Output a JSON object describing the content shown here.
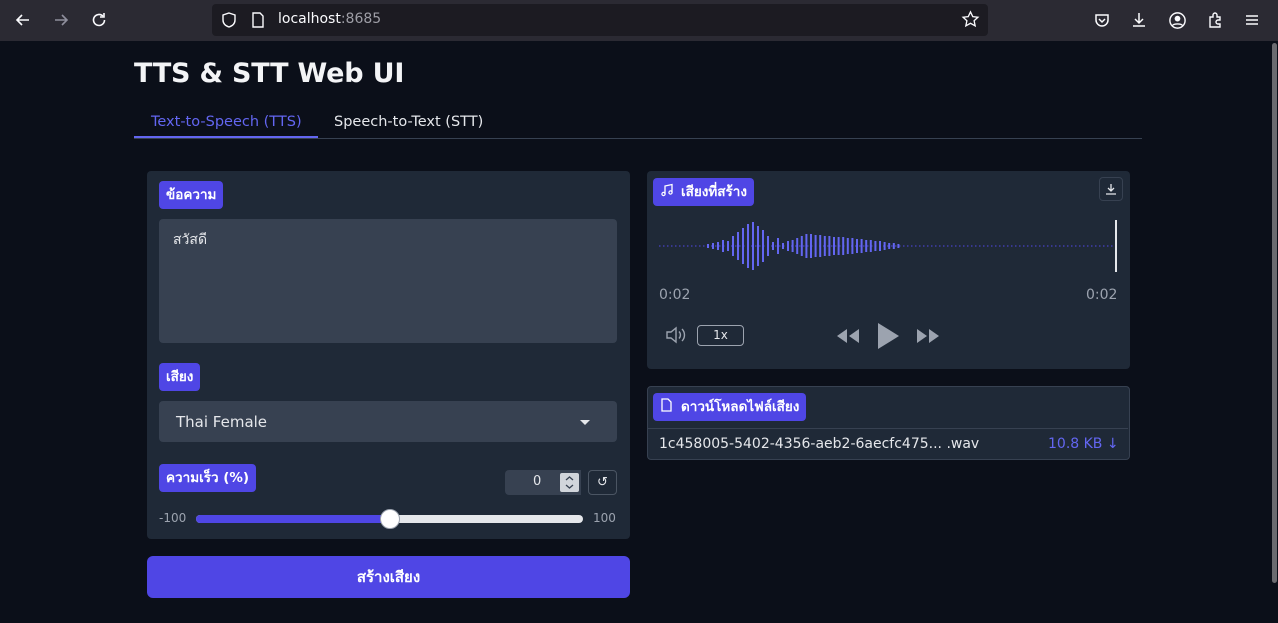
{
  "browser": {
    "url_host": "localhost",
    "url_port": ":8685"
  },
  "app": {
    "title": "TTS & STT Web UI"
  },
  "tabs": [
    {
      "label": "Text-to-Speech (TTS)",
      "active": true
    },
    {
      "label": "Speech-to-Text (STT)",
      "active": false
    }
  ],
  "tts": {
    "text_label": "ข้อความ",
    "text_value": "สวัสดี",
    "voice_label": "เสียง",
    "voice_value": "Thai Female",
    "speed_label": "ความเร็ว (%)",
    "speed_value": "0",
    "reset_glyph": "↺",
    "slider_min": "-100",
    "slider_max": "100",
    "slider_level": 0.5,
    "generate_button": "สร้างเสียง"
  },
  "audio": {
    "label": "เสียงที่สร้าง",
    "time_current": "0:02",
    "time_total": "0:02",
    "playback_rate": "1x"
  },
  "download": {
    "label": "ดาวน์โหลดไฟล์เสียง",
    "file_name": "1c458005-5402-4356-aeb2-6aecfc475... .wav",
    "file_size": "10.8 KB ↓"
  },
  "colors": {
    "accent": "#4f46e5",
    "accent_text": "#6366f1",
    "panel": "#1f2937",
    "page_bg": "#0b0f19"
  },
  "icons": [
    "back-icon",
    "forward-icon",
    "reload-icon",
    "shield-icon",
    "page-icon",
    "bookmark-star-icon",
    "pocket-icon",
    "downloads-icon",
    "account-icon",
    "extensions-icon",
    "menu-icon",
    "music-note-icon",
    "download-icon",
    "volume-icon",
    "rewind-icon",
    "play-icon",
    "fast-forward-icon",
    "file-icon"
  ]
}
